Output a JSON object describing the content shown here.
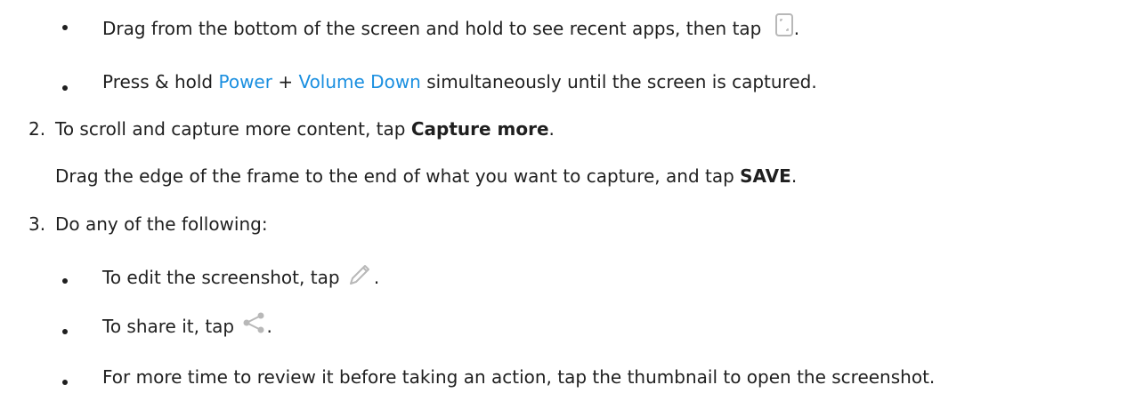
{
  "colors": {
    "link": "#1a8fe0",
    "text": "#1f1f1f"
  },
  "step1": {
    "bullet1": {
      "text": "Drag from the bottom of the screen and hold to see recent apps, then tap",
      "icon": "screenshot-icon",
      "suffix": "."
    },
    "bullet2": {
      "prefix": "Press & hold",
      "power": "Power",
      "plus": "+",
      "volume_down": "Volume Down",
      "suffix": "simultaneously until the screen is captured."
    }
  },
  "step2": {
    "number": "2.",
    "text": "To scroll and capture more content, tap",
    "bold": "Capture more",
    "end": ".",
    "sub_text": "Drag the edge of the frame to the end of what you want to capture, and tap",
    "sub_bold": "SAVE",
    "sub_end": "."
  },
  "step3": {
    "number": "3.",
    "text": "Do any of the following:",
    "items": [
      {
        "text": "To edit the screenshot, tap",
        "icon": "pencil-icon",
        "suffix": "."
      },
      {
        "text": "To share it, tap",
        "icon": "share-icon",
        "suffix": "."
      },
      {
        "text": "For more time to review it before taking an action, tap the thumbnail to open the screenshot."
      }
    ]
  }
}
